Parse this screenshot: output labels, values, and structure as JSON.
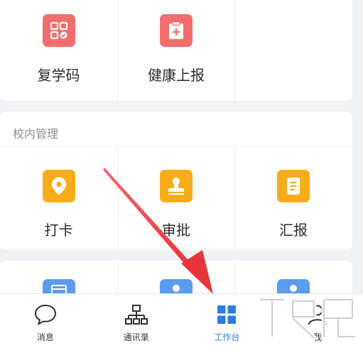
{
  "top_apps": [
    {
      "label": "复学码",
      "icon": "qr-code-check-icon"
    },
    {
      "label": "健康上报",
      "icon": "clipboard-plus-icon"
    }
  ],
  "school_section": {
    "title": "校内管理",
    "apps": [
      {
        "label": "打卡",
        "icon": "location-pin-icon"
      },
      {
        "label": "审批",
        "icon": "stamp-icon"
      },
      {
        "label": "汇报",
        "icon": "document-icon"
      }
    ]
  },
  "bottom_apps": [
    {
      "icon": "calendar-icon"
    },
    {
      "icon": "user-icon"
    },
    {
      "icon": "user-icon"
    }
  ],
  "tabs": [
    {
      "label": "消息",
      "icon": "chat-bubble-icon",
      "active": false
    },
    {
      "label": "通讯录",
      "icon": "org-chart-icon",
      "active": false
    },
    {
      "label": "工作台",
      "icon": "grid-icon",
      "active": true
    },
    {
      "label": "我",
      "icon": "person-icon",
      "active": false
    }
  ],
  "colors": {
    "red_tile": "#f26e6e",
    "orange_tile": "#f9ac1a",
    "blue_tile": "#5b9cf0",
    "active_tab": "#2e7de6",
    "arrow": "#e8343b"
  }
}
